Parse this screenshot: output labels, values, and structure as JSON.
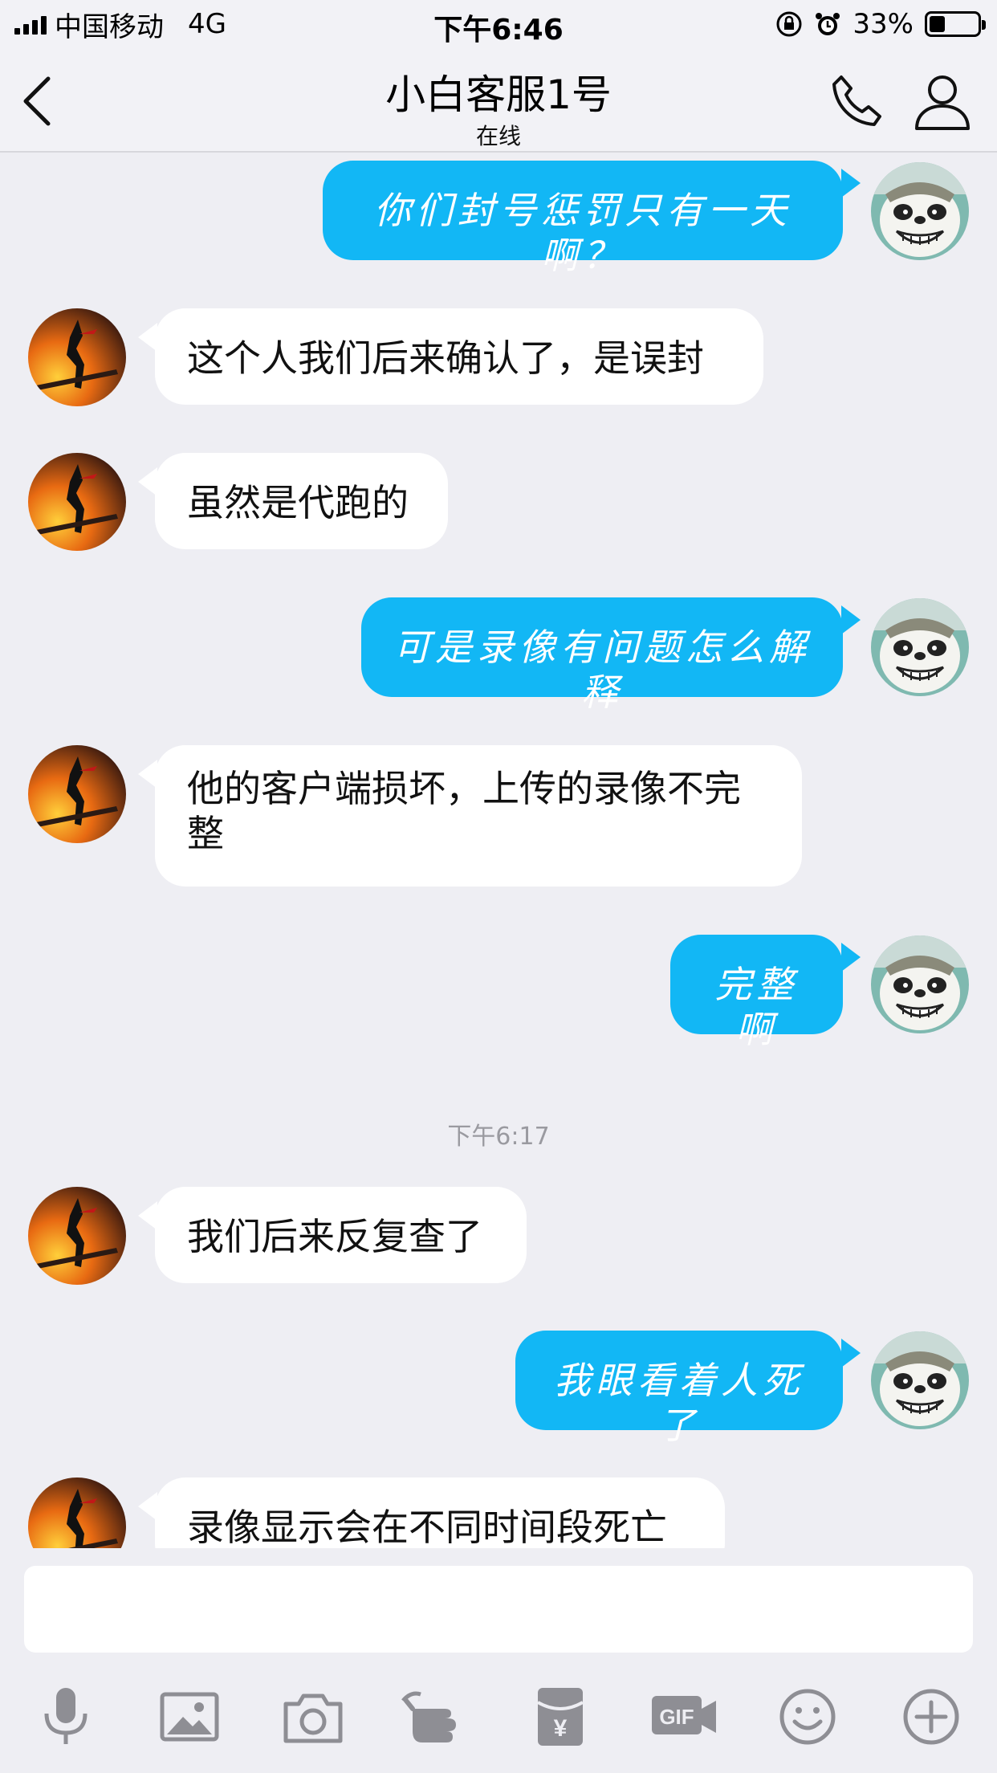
{
  "status_bar": {
    "carrier": "中国移动",
    "network": "4G",
    "time": "下午6:46",
    "battery": "33%",
    "battery_level": 0.33,
    "icons": [
      "signal-icon",
      "orientation-lock-icon",
      "alarm-icon",
      "battery-icon"
    ]
  },
  "nav": {
    "title": "小白客服1号",
    "subtitle": "在线",
    "icons": [
      "back-arrow-icon",
      "phone-icon",
      "profile-icon"
    ]
  },
  "messages": [
    {
      "side": "out",
      "text": "你们封号惩罚只有一天啊？"
    },
    {
      "side": "in",
      "text": "这个人我们后来确认了，是误封"
    },
    {
      "side": "in",
      "text": "虽然是代跑的"
    },
    {
      "side": "out",
      "text": "可是录像有问题怎么解释"
    },
    {
      "side": "in",
      "text": "他的客户端损坏，上传的录像不完整"
    },
    {
      "side": "out",
      "text": "完整啊"
    },
    {
      "side": "in",
      "text": "我们后来反复查了"
    },
    {
      "side": "out",
      "text": "我眼看着人死了"
    },
    {
      "side": "in",
      "text": "录像显示会在不同时间段死亡"
    }
  ],
  "timestamp": "下午6:17",
  "input": {
    "value": "",
    "placeholder": ""
  },
  "toolbar": {
    "icons": [
      "microphone-icon",
      "image-icon",
      "camera-icon",
      "poke-hand-icon",
      "red-packet-icon",
      "gif-icon",
      "emoji-icon",
      "plus-icon"
    ],
    "gif_label": "GIF",
    "yen": "¥"
  },
  "colors": {
    "outgoing_bubble": "#12b7f5",
    "incoming_bubble": "#ffffff",
    "background": "#eeeef3",
    "icon_gray": "#8e8e94"
  }
}
